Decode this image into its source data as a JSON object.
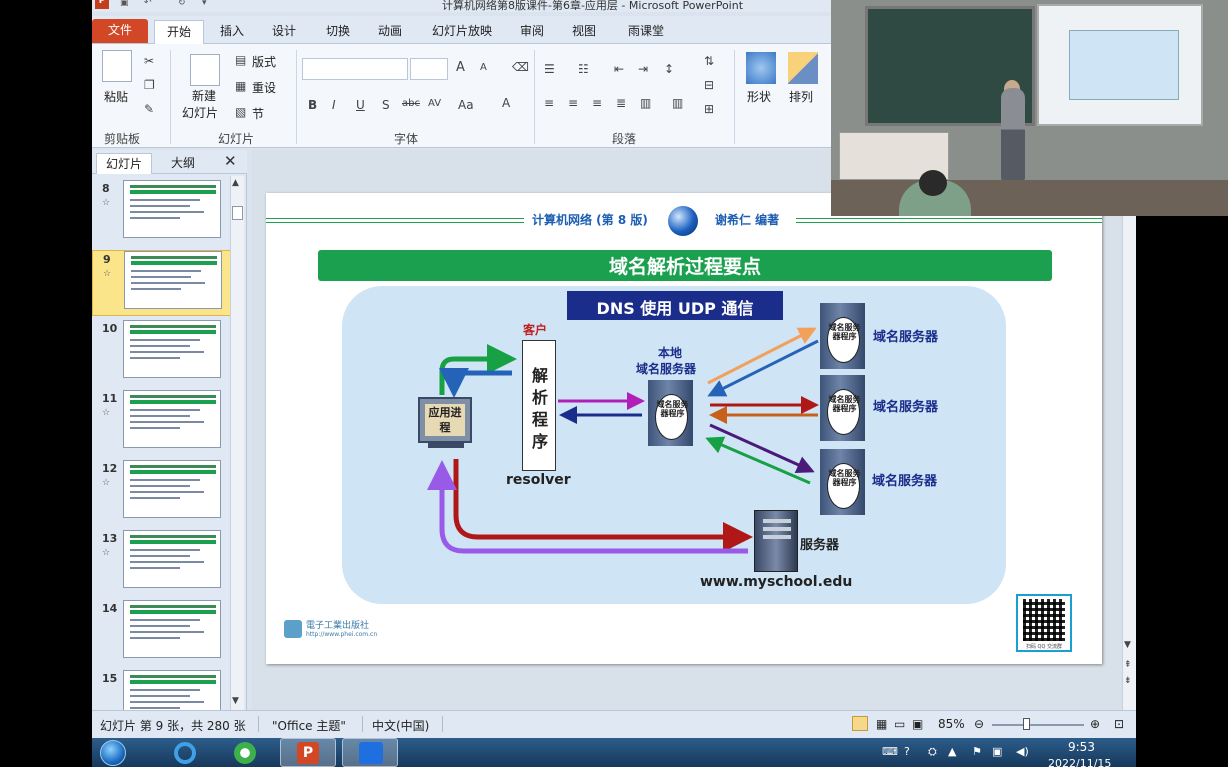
{
  "window": {
    "title": "计算机网络第8版课件-第6章-应用层 - Microsoft PowerPoint",
    "app_logo": "P"
  },
  "ribbon_tabs": [
    "文件",
    "开始",
    "插入",
    "设计",
    "切换",
    "动画",
    "幻灯片放映",
    "审阅",
    "视图",
    "雨课堂"
  ],
  "ribbon": {
    "clipboard": {
      "paste": "粘贴",
      "group": "剪贴板"
    },
    "slides": {
      "new_slide_1": "新建",
      "new_slide_2": "幻灯片",
      "layout": "版式",
      "reset": "重设",
      "section": "节",
      "group": "幻灯片"
    },
    "font": {
      "group": "字体",
      "bold": "B",
      "italic": "I",
      "underline": "U",
      "shadow": "S",
      "strike": "abc",
      "spacing": "AV",
      "case": "Aa",
      "color": "A",
      "grow": "A",
      "shrink": "A"
    },
    "paragraph": {
      "group": "段落"
    },
    "drawing": {
      "shapes": "形状",
      "arrange": "排列"
    }
  },
  "pane": {
    "tab_slides": "幻灯片",
    "tab_outline": "大纲",
    "close": "✕",
    "thumbnails": [
      {
        "num": "8",
        "star": "☆"
      },
      {
        "num": "9",
        "star": "☆"
      },
      {
        "num": "10",
        "star": ""
      },
      {
        "num": "11",
        "star": "☆"
      },
      {
        "num": "12",
        "star": "☆"
      },
      {
        "num": "13",
        "star": "☆"
      },
      {
        "num": "14",
        "star": ""
      },
      {
        "num": "15",
        "star": ""
      }
    ],
    "selected_index": 1
  },
  "slide": {
    "header_left": "计算机网络 (第 8 版)",
    "header_right": "谢希仁 编著",
    "title": "域名解析过程要点",
    "dns_banner": "DNS 使用 UDP 通信",
    "client_label": "客户",
    "resolver_chars": "解析程序",
    "resolver_label": "resolver",
    "app_process": "应用进程",
    "local_dns_1": "本地",
    "local_dns_2": "域名服务器",
    "server_oval_text": "域名服务器程序",
    "dns_server_label": "域名服务器",
    "web_server_label": "服务器",
    "web_server_host": "www.myschool.edu",
    "publisher": "電子工業出版社",
    "publisher_url": "http://www.phei.com.cn",
    "qr_caption": "扫码 QQ 交流群"
  },
  "statusbar": {
    "slide_info": "幻灯片 第 9 张，共 280 张",
    "theme": "\"Office 主题\"",
    "language": "中文(中国)",
    "zoom": "85%"
  },
  "taskbar": {
    "time": "9:53",
    "date": "2022/11/15"
  },
  "colors": {
    "accent_green": "#1aa04e",
    "title_blue": "#1c5fb2",
    "dns_navy": "#1b2d8a",
    "ribbon_file": "#d24726"
  }
}
